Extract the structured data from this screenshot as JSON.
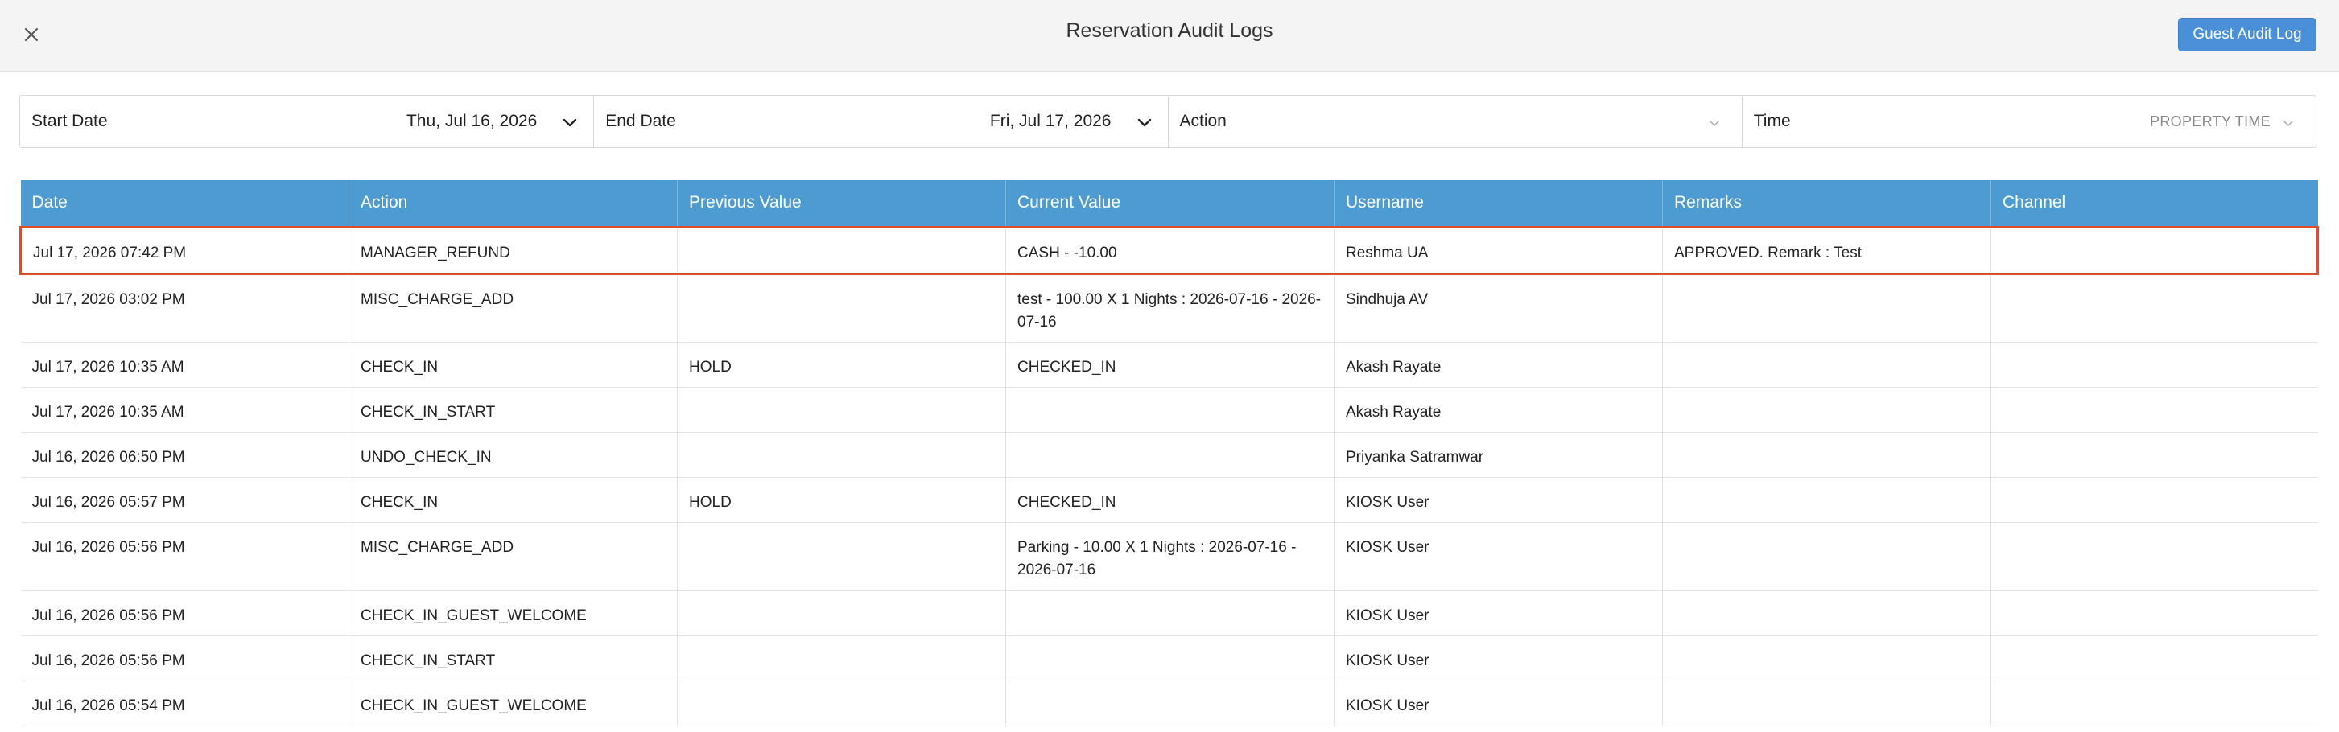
{
  "header": {
    "title": "Reservation Audit Logs",
    "close_icon": "close-icon",
    "guest_audit_button": "Guest Audit Log",
    "accent_color": "#4a90d9"
  },
  "filters": {
    "start_date": {
      "label": "Start Date",
      "value": "Thu, Jul 16, 2026"
    },
    "end_date": {
      "label": "End Date",
      "value": "Fri, Jul 17, 2026"
    },
    "action": {
      "label": "Action",
      "value": ""
    },
    "time": {
      "label": "Time",
      "value": "PROPERTY TIME"
    }
  },
  "table": {
    "header_color": "#4d9bd1",
    "highlight_color": "#e24a2c",
    "columns": [
      "Date",
      "Action",
      "Previous Value",
      "Current Value",
      "Username",
      "Remarks",
      "Channel"
    ],
    "rows": [
      {
        "date": "Jul 17, 2026 07:42 PM",
        "action": "MANAGER_REFUND",
        "previous": "",
        "current": "CASH - -10.00",
        "username": "Reshma UA",
        "remarks": "APPROVED. Remark : Test",
        "channel": ""
      },
      {
        "date": "Jul 17, 2026 03:02 PM",
        "action": "MISC_CHARGE_ADD",
        "previous": "",
        "current": "test - 100.00 X 1 Nights : 2026-07-16 - 2026-07-16",
        "username": "Sindhuja AV",
        "remarks": "",
        "channel": ""
      },
      {
        "date": "Jul 17, 2026 10:35 AM",
        "action": "CHECK_IN",
        "previous": "HOLD",
        "current": "CHECKED_IN",
        "username": "Akash Rayate",
        "remarks": "",
        "channel": ""
      },
      {
        "date": "Jul 17, 2026 10:35 AM",
        "action": "CHECK_IN_START",
        "previous": "",
        "current": "",
        "username": "Akash Rayate",
        "remarks": "",
        "channel": ""
      },
      {
        "date": "Jul 16, 2026 06:50 PM",
        "action": "UNDO_CHECK_IN",
        "previous": "",
        "current": "",
        "username": "Priyanka Satramwar",
        "remarks": "",
        "channel": ""
      },
      {
        "date": "Jul 16, 2026 05:57 PM",
        "action": "CHECK_IN",
        "previous": "HOLD",
        "current": "CHECKED_IN",
        "username": "KIOSK User",
        "remarks": "",
        "channel": ""
      },
      {
        "date": "Jul 16, 2026 05:56 PM",
        "action": "MISC_CHARGE_ADD",
        "previous": "",
        "current": "Parking - 10.00 X 1 Nights : 2026-07-16 - 2026-07-16",
        "username": "KIOSK User",
        "remarks": "",
        "channel": ""
      },
      {
        "date": "Jul 16, 2026 05:56 PM",
        "action": "CHECK_IN_GUEST_WELCOME",
        "previous": "",
        "current": "",
        "username": "KIOSK User",
        "remarks": "",
        "channel": ""
      },
      {
        "date": "Jul 16, 2026 05:56 PM",
        "action": "CHECK_IN_START",
        "previous": "",
        "current": "",
        "username": "KIOSK User",
        "remarks": "",
        "channel": ""
      },
      {
        "date": "Jul 16, 2026 05:54 PM",
        "action": "CHECK_IN_GUEST_WELCOME",
        "previous": "",
        "current": "",
        "username": "KIOSK User",
        "remarks": "",
        "channel": ""
      }
    ]
  }
}
